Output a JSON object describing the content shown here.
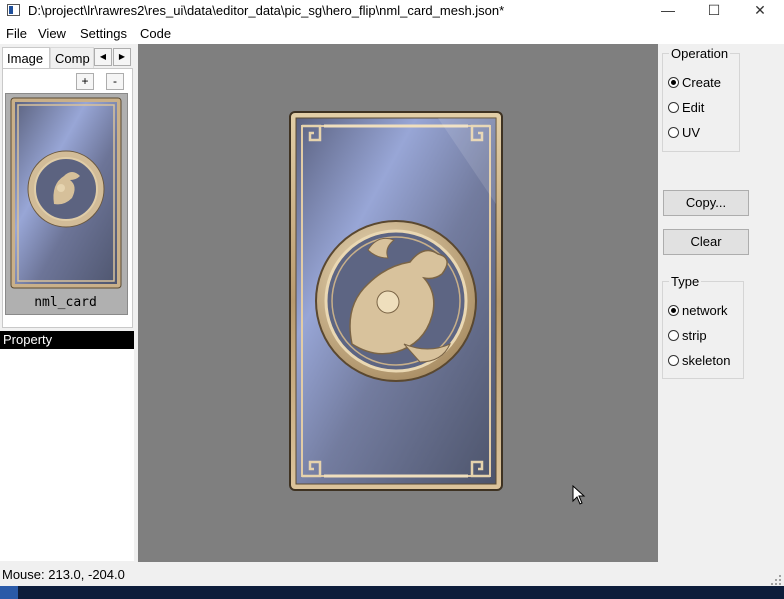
{
  "window": {
    "title": "D:\\project\\lr\\rawres2\\res_ui\\data\\editor_data\\pic_sg\\hero_flip\\nml_card_mesh.json*",
    "minimize_glyph": "—",
    "maximize_glyph": "☐",
    "close_glyph": "✕"
  },
  "menu": {
    "file": "File",
    "view": "View",
    "settings": "Settings",
    "code": "Code"
  },
  "left_panel": {
    "tabs": [
      "Image",
      "Comp"
    ],
    "scroll_left": "◀",
    "scroll_right": "▶",
    "add_label": "+",
    "remove_label": "-",
    "thumbnail_label": "nml_card",
    "property_header": "Property"
  },
  "operation": {
    "title": "Operation",
    "options": [
      "Create",
      "Edit",
      "UV"
    ],
    "selected": "Create"
  },
  "buttons": {
    "copy": "Copy...",
    "clear": "Clear"
  },
  "type": {
    "title": "Type",
    "options": [
      "network",
      "strip",
      "skeleton"
    ],
    "selected": "network"
  },
  "status": {
    "mouse": "Mouse: 213.0, -204.0"
  },
  "colors": {
    "canvas_bg": "#7f7f7f",
    "card_blue_light": "#98a6d6",
    "card_blue_dark": "#5c6380",
    "frame_gold": "#c9b08a",
    "property_header_bg": "#000000"
  }
}
